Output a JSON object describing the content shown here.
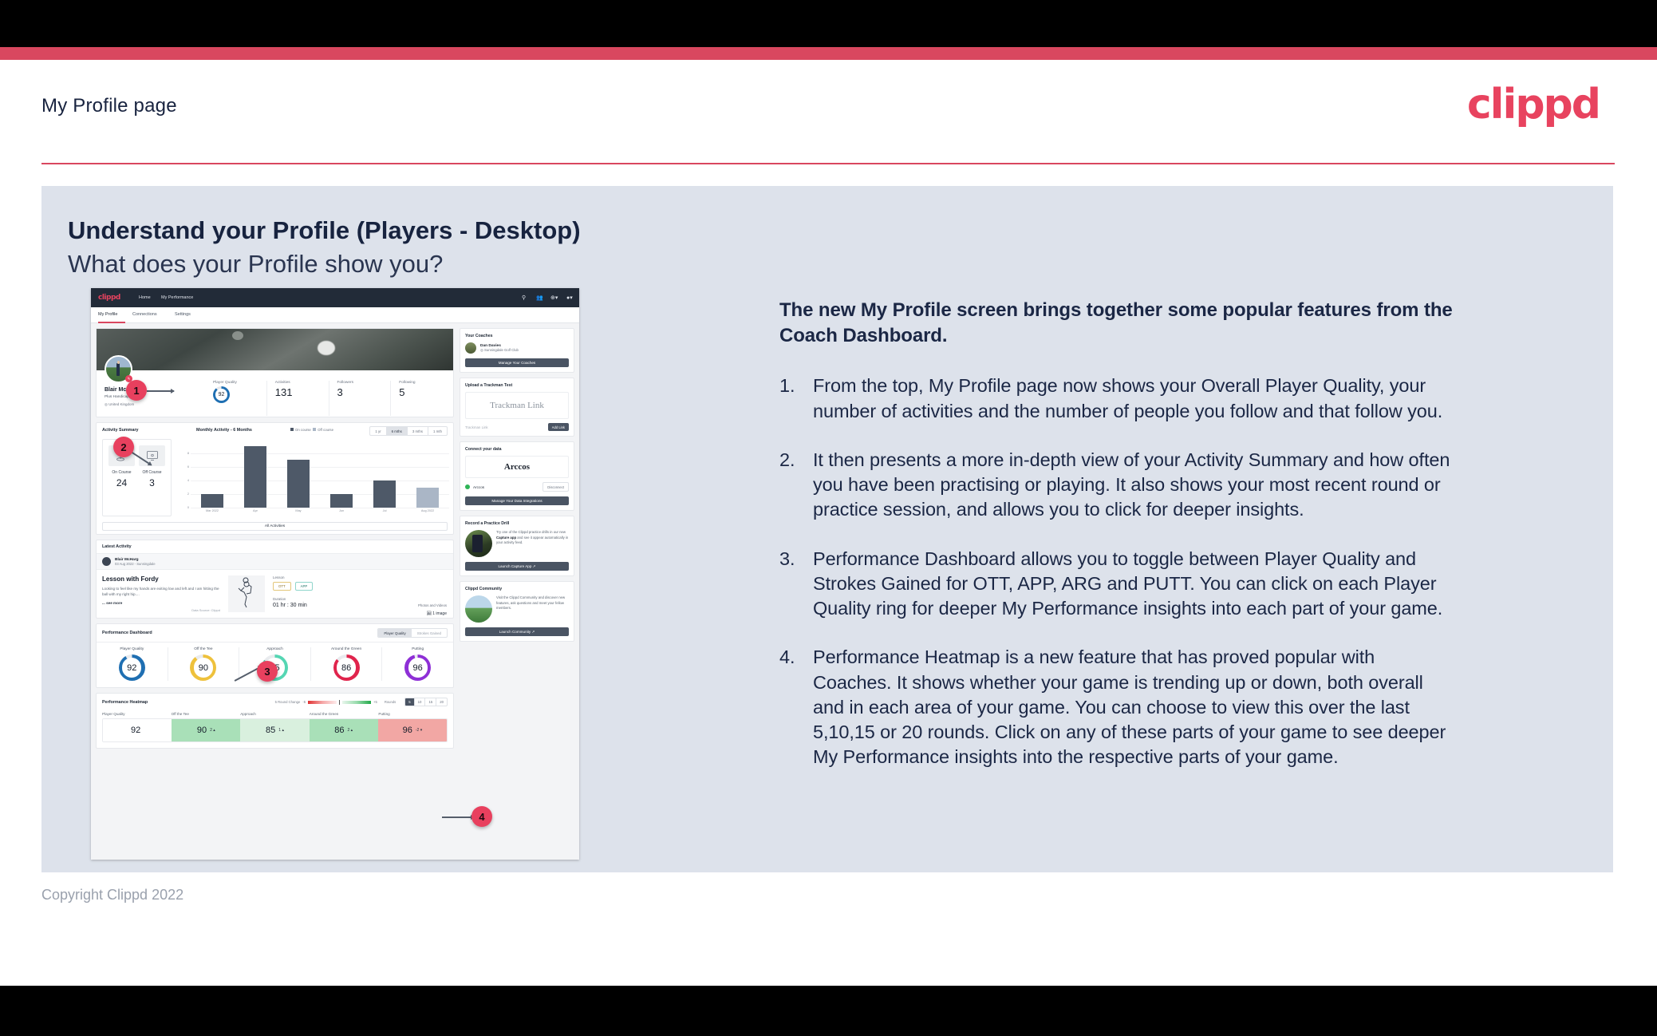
{
  "slide": {
    "header_title": "My Profile page",
    "logo_text": "clippd",
    "heading_line1": "Understand your Profile (Players - Desktop)",
    "heading_line2": "What does your Profile show you?",
    "copyright": "Copyright Clippd 2022"
  },
  "right_column": {
    "lead": "The new My Profile screen brings together some popular features from the Coach Dashboard.",
    "items": [
      {
        "num": "1.",
        "text": "From the top, My Profile page now shows your Overall Player Quality, your number of activities and the number of people you follow and that follow you."
      },
      {
        "num": "2.",
        "text": "It then presents a more in-depth view of your Activity Summary and how often you have been practising or playing. It also shows your most recent round or practice session, and allows you to click for deeper insights."
      },
      {
        "num": "3.",
        "text": "Performance Dashboard allows you to toggle between Player Quality and Strokes Gained for OTT, APP, ARG and PUTT. You can click on each Player Quality ring for deeper My Performance insights into each part of your game."
      },
      {
        "num": "4.",
        "text": "Performance Heatmap is a new feature that has proved popular with Coaches. It shows whether your game is trending up or down, both overall and in each area of your game. You can choose to view this over the last 5,10,15 or 20 rounds. Click on any of these parts of your game to see deeper My Performance insights into the respective parts of your game."
      }
    ]
  },
  "callouts": [
    {
      "label": "1"
    },
    {
      "label": "2"
    },
    {
      "label": "3"
    },
    {
      "label": "4"
    }
  ],
  "app": {
    "nav": {
      "logo": "clippd",
      "links": [
        "Home",
        "My Performance"
      ],
      "icons": [
        "search-icon",
        "people-icon",
        "add-circle-icon",
        "avatar-icon"
      ]
    },
    "tabs": [
      {
        "label": "My Profile",
        "active": true
      },
      {
        "label": "Connections",
        "active": false
      },
      {
        "label": "Settings",
        "active": false
      }
    ],
    "profile": {
      "name": "Blair McHarg",
      "handicap": "Plus Handicap",
      "location": "United Kingdom",
      "stats": [
        {
          "label": "Player Quality",
          "value": "92",
          "type": "ring"
        },
        {
          "label": "Activities",
          "value": "131",
          "type": "number"
        },
        {
          "label": "Followers",
          "value": "3",
          "type": "number"
        },
        {
          "label": "Following",
          "value": "5",
          "type": "number"
        }
      ]
    },
    "activity_summary": {
      "title": "Activity Summary",
      "chart_title": "Monthly Activity - 6 Months",
      "legend": [
        "On course",
        "Off course"
      ],
      "range_options": [
        {
          "label": "1 yr",
          "active": false
        },
        {
          "label": "6 mths",
          "active": true
        },
        {
          "label": "3 mths",
          "active": false
        },
        {
          "label": "1 mth",
          "active": false
        }
      ],
      "tiles": [
        {
          "label": "On Course",
          "value": "24",
          "icon": "golf-flag-icon"
        },
        {
          "label": "Off Course",
          "value": "3",
          "icon": "monitor-icon"
        }
      ],
      "all_activities_label": "All Activities"
    },
    "latest_activity": {
      "header": "Latest Activity",
      "user_name": "Blair McHarg",
      "user_date": "03 Aug 2022 - Sunningdale",
      "title": "Lesson with Fordy",
      "description": "Looking to feel like my hands are exiting low and left and I am hitting the ball with my right hip....",
      "see_more": "... see more",
      "data_source": "Data Source: Clippd",
      "lesson_label": "Lesson",
      "chips": [
        "OTT",
        "APP"
      ],
      "duration_label": "Duration",
      "duration_value": "01 hr : 30 min",
      "media_label": "Photos and Videos",
      "media_value": "1 image"
    },
    "performance_dashboard": {
      "title": "Performance Dashboard",
      "toggle": [
        {
          "label": "Player Quality",
          "active": true
        },
        {
          "label": "Strokes Gained",
          "active": false
        }
      ],
      "rings": [
        {
          "label": "Player Quality",
          "value": "92",
          "color": "#1f6fb2"
        },
        {
          "label": "Off the Tee",
          "value": "90",
          "color": "#eec13c"
        },
        {
          "label": "Approach",
          "value": "85",
          "color": "#55d6b3"
        },
        {
          "label": "Around the Green",
          "value": "86",
          "color": "#e0244c"
        },
        {
          "label": "Putting",
          "value": "96",
          "color": "#8e2fd6"
        }
      ]
    },
    "performance_heatmap": {
      "title": "Performance Heatmap",
      "scale_label": "5 Round Change",
      "scale_min": "-5",
      "scale_max": "+5",
      "rounds_label": "Rounds",
      "rounds_options": [
        {
          "label": "5",
          "active": true
        },
        {
          "label": "10",
          "active": false
        },
        {
          "label": "15",
          "active": false
        },
        {
          "label": "20",
          "active": false
        }
      ],
      "cells": [
        {
          "label": "Player Quality",
          "value": "92",
          "delta": "",
          "bg": "#ffffff"
        },
        {
          "label": "Off the Tee",
          "value": "90",
          "delta": "2 ▴",
          "bg": "#a9e0b8"
        },
        {
          "label": "Approach",
          "value": "85",
          "delta": "1 ▴",
          "bg": "#d9f0de"
        },
        {
          "label": "Around the Green",
          "value": "86",
          "delta": "2 ▴",
          "bg": "#a9e0b8"
        },
        {
          "label": "Putting",
          "value": "96",
          "delta": "-2 ▾",
          "bg": "#f2a7a4"
        }
      ]
    },
    "sidebar": {
      "coaches": {
        "title": "Your Coaches",
        "coach_name": "Dan Davies",
        "coach_club": "Sunningdale Golf Club",
        "button": "Manage Your Coaches"
      },
      "trackman": {
        "title": "Upload a Trackman Test",
        "box_text": "Trackman Link",
        "input_placeholder": "Trackman Link",
        "add_button": "Add Link"
      },
      "connect": {
        "title": "Connect your data",
        "brand": "Arccos",
        "source_name": "Arccos",
        "disconnect": "Disconnect",
        "button": "Manage Your Data Integrations"
      },
      "drill": {
        "title": "Record a Practice Drill",
        "text_1": "Try one of the Clippd practice drills in our new ",
        "text_bold": "Capture app",
        "text_2": " and see it appear automatically in your activity feed.",
        "button": "Launch Capture App"
      },
      "community": {
        "title": "Clippd Community",
        "text": "Visit the Clippd Community and discover new features, ask questions and meet your fellow members.",
        "button": "Launch Community"
      }
    }
  },
  "chart_data": {
    "type": "bar",
    "title": "Monthly Activity - 6 Months",
    "categories": [
      "Mar 2022",
      "Apr",
      "May",
      "Jun",
      "Jul",
      "Aug 2022"
    ],
    "series": [
      {
        "name": "On course",
        "values": [
          2,
          9,
          7,
          2,
          4,
          null
        ],
        "color": "#4e5968"
      },
      {
        "name": "Off course",
        "values": [
          null,
          null,
          null,
          null,
          null,
          3
        ],
        "color": "#aab6c6"
      }
    ],
    "values": [
      2,
      9,
      7,
      2,
      4,
      3
    ],
    "yticks": [
      0,
      2,
      4,
      6,
      8
    ],
    "ylim": [
      0,
      9.6
    ],
    "xlabel": "",
    "ylabel": "",
    "grid": true,
    "legend_position": "top-right"
  }
}
